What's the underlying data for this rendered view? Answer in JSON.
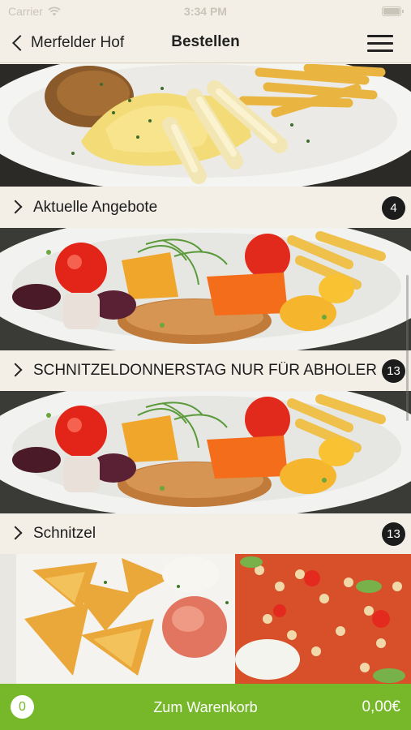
{
  "status": {
    "carrier": "Carrier",
    "time": "3:34 PM"
  },
  "nav": {
    "back_label": "Merfelder Hof",
    "title": "Bestellen"
  },
  "categories": [
    {
      "label": "Aktuelle Angebote",
      "count": "4"
    },
    {
      "label": "SCHNITZELDONNERSTAG NUR FÜR ABHOLER",
      "count": "13"
    },
    {
      "label": "Schnitzel",
      "count": "13"
    }
  ],
  "cart": {
    "count": "0",
    "label": "Zum Warenkorb",
    "total": "0,00€"
  },
  "colors": {
    "accent": "#76b82a",
    "background": "#f3efe6",
    "badge": "#1c1c1c"
  }
}
